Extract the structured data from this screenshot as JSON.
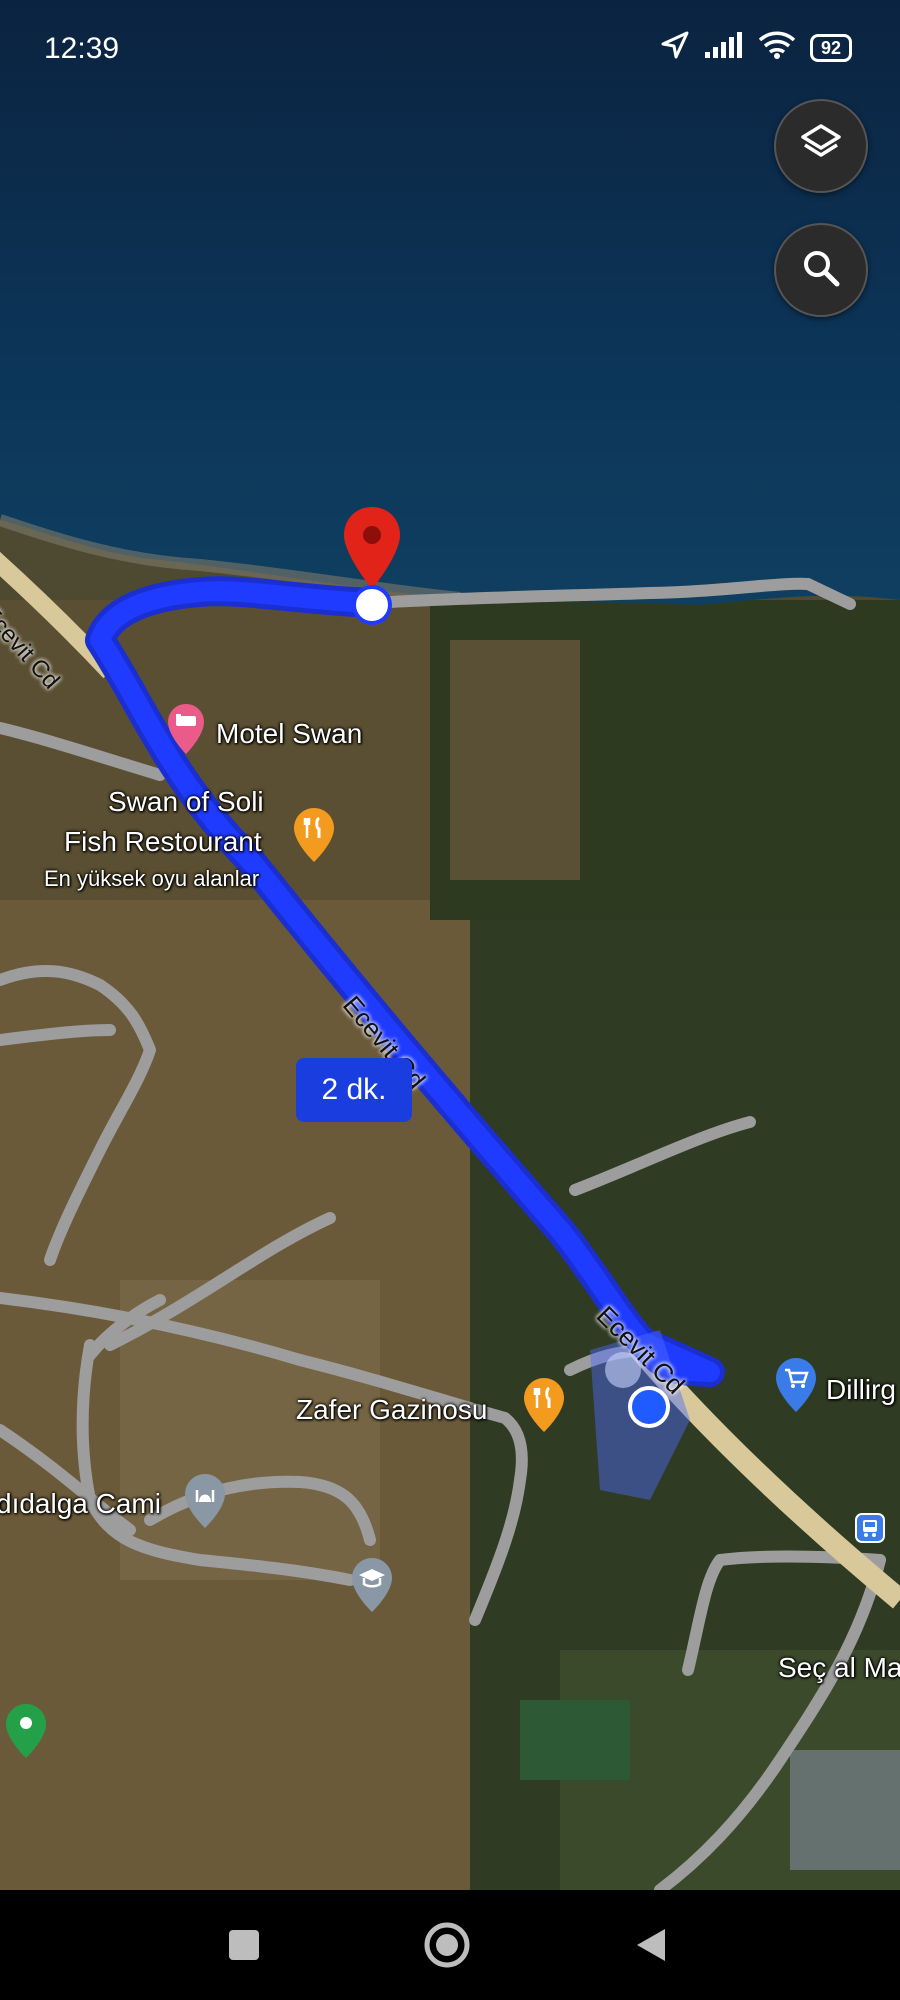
{
  "status_bar": {
    "time": "12:39",
    "battery": "92"
  },
  "map": {
    "eta_label": "2 dk.",
    "roads": [
      {
        "label": "Ecevit Cd"
      },
      {
        "label": "Ecevit Cd"
      },
      {
        "label": "Ecevit Cd"
      }
    ],
    "places": {
      "motel": "Motel Swan",
      "restaurant_line1": "Swan of Soli",
      "restaurant_line2": "Fish Restourant",
      "restaurant_note": "En yüksek oyu alanlar",
      "gazino": "Zafer Gazinosu",
      "mosque": "dıdalga Cami",
      "shop": "Dillirg",
      "market": "Seç al Ma"
    }
  },
  "colors": {
    "route": "#1f3bff",
    "sea": "#0b2f55",
    "road": "#9a9a9a",
    "eta_bg": "#1a3de0"
  },
  "icons": [
    "layers-icon",
    "search-icon",
    "destination-pin-icon",
    "current-location-icon",
    "hotel-icon",
    "restaurant-icon",
    "mosque-icon",
    "school-icon",
    "shopping-cart-icon",
    "bus-stop-icon",
    "green-pin-icon",
    "location-arrow-icon",
    "signal-icon",
    "wifi-icon"
  ]
}
